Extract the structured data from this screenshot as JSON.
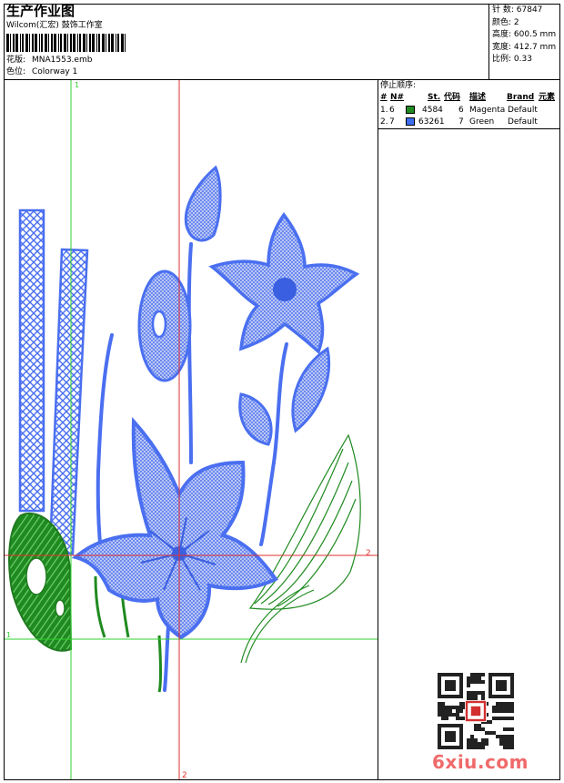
{
  "header": {
    "title": "生产作业图",
    "company": "Wilcom(汇宏) 鼓饰工作室",
    "design_label": "花版:",
    "design_value": "MNA1553.emb",
    "colorway_label": "色位:",
    "colorway_value": "Colorway 1"
  },
  "stats": [
    {
      "label": "针 数:",
      "value": "67847"
    },
    {
      "label": "颜色:",
      "value": "2"
    },
    {
      "label": "高度:",
      "value": "600.5 mm"
    },
    {
      "label": "宽度:",
      "value": "412.7 mm"
    },
    {
      "label": "比例:",
      "value": "0.33"
    }
  ],
  "stop_sequence": {
    "title": "停止顺序:",
    "headers": {
      "num": "#",
      "no": "N#",
      "st": "St.",
      "code": "代码",
      "desc": "描述",
      "brand": "Brand",
      "element": "元素"
    },
    "rows": [
      {
        "num": "1.",
        "no": "6",
        "color": "#1f8a1f",
        "st": "4584",
        "code": "6",
        "desc": "Magenta",
        "brand": "Default"
      },
      {
        "num": "2.",
        "no": "7",
        "color": "#3d6ef0",
        "st": "63261",
        "code": "7",
        "desc": "Green",
        "brand": "Default"
      }
    ]
  },
  "guides": {
    "green_label": "1",
    "red_label": "2"
  },
  "watermark": "6xiu.com",
  "colors": {
    "blue": "#4a6ff0",
    "green": "#1f8a1f",
    "red_guide": "#e23030",
    "green_guide": "#2fd02f"
  }
}
